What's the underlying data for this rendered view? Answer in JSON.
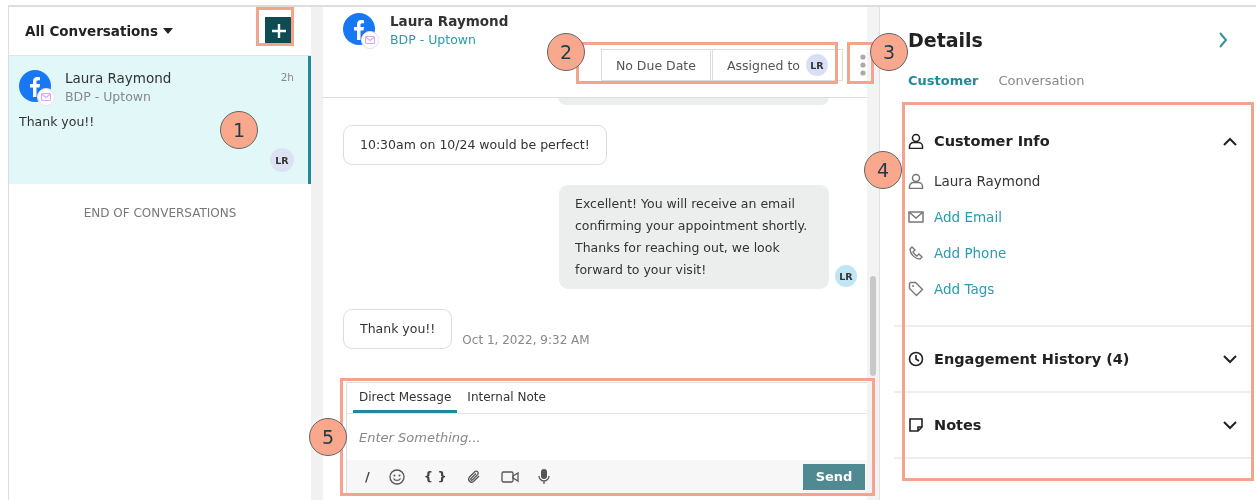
{
  "conversation_list": {
    "title": "All Conversations",
    "items": [
      {
        "name": "Laura Raymond",
        "location": "BDP - Uptown",
        "time": "2h",
        "preview": "Thank you!!",
        "assignee": "LR",
        "selected": true
      }
    ],
    "end_label": "END OF CONVERSATIONS"
  },
  "conversation": {
    "name": "Laura Raymond",
    "location": "BDP - Uptown",
    "due_date": "No Due Date",
    "assigned_label": "Assigned to",
    "assignee": "LR",
    "messages": [
      {
        "kind": "outgoing",
        "partial": true
      },
      {
        "kind": "incoming",
        "text": "10:30am on 10/24 would be perfect!"
      },
      {
        "kind": "outgoing",
        "text": "Excellent! You will receive an email confirming your appointment shortly. Thanks for reaching out, we look forward to your visit!",
        "avatar": "LR"
      },
      {
        "kind": "incoming",
        "text": "Thank you!!",
        "time": "Oct 1, 2022, 9:32 AM"
      }
    ],
    "composer": {
      "tabs": [
        {
          "label": "Direct Message",
          "selected": true
        },
        {
          "label": "Internal Note",
          "selected": false
        }
      ],
      "placeholder": "Enter Something...",
      "toolbar": [
        {
          "kind": "text",
          "text": "/"
        },
        {
          "kind": "emoji"
        },
        {
          "kind": "text",
          "text": "{ }"
        },
        {
          "kind": "attach"
        },
        {
          "kind": "video"
        },
        {
          "kind": "mic"
        }
      ],
      "send": "Send"
    }
  },
  "details": {
    "title": "Details",
    "tabs": [
      {
        "label": "Customer",
        "selected": true
      },
      {
        "label": "Conversation",
        "selected": false
      }
    ],
    "sections": [
      {
        "kind": "person",
        "title": "Customer Info",
        "expanded": true,
        "fields": [
          {
            "kind": "person",
            "text": "Laura Raymond",
            "link": false
          },
          {
            "kind": "mail",
            "text": "Add Email",
            "link": true
          },
          {
            "kind": "phone",
            "text": "Add Phone",
            "link": true
          },
          {
            "kind": "tag",
            "text": "Add Tags",
            "link": true
          }
        ]
      },
      {
        "kind": "clock",
        "title": "Engagement History (4)",
        "expanded": false
      },
      {
        "kind": "note",
        "title": "Notes",
        "expanded": false
      }
    ]
  },
  "callouts": [
    {
      "label": "1"
    },
    {
      "label": "2"
    },
    {
      "label": "3"
    },
    {
      "label": "4"
    },
    {
      "label": "5"
    }
  ]
}
